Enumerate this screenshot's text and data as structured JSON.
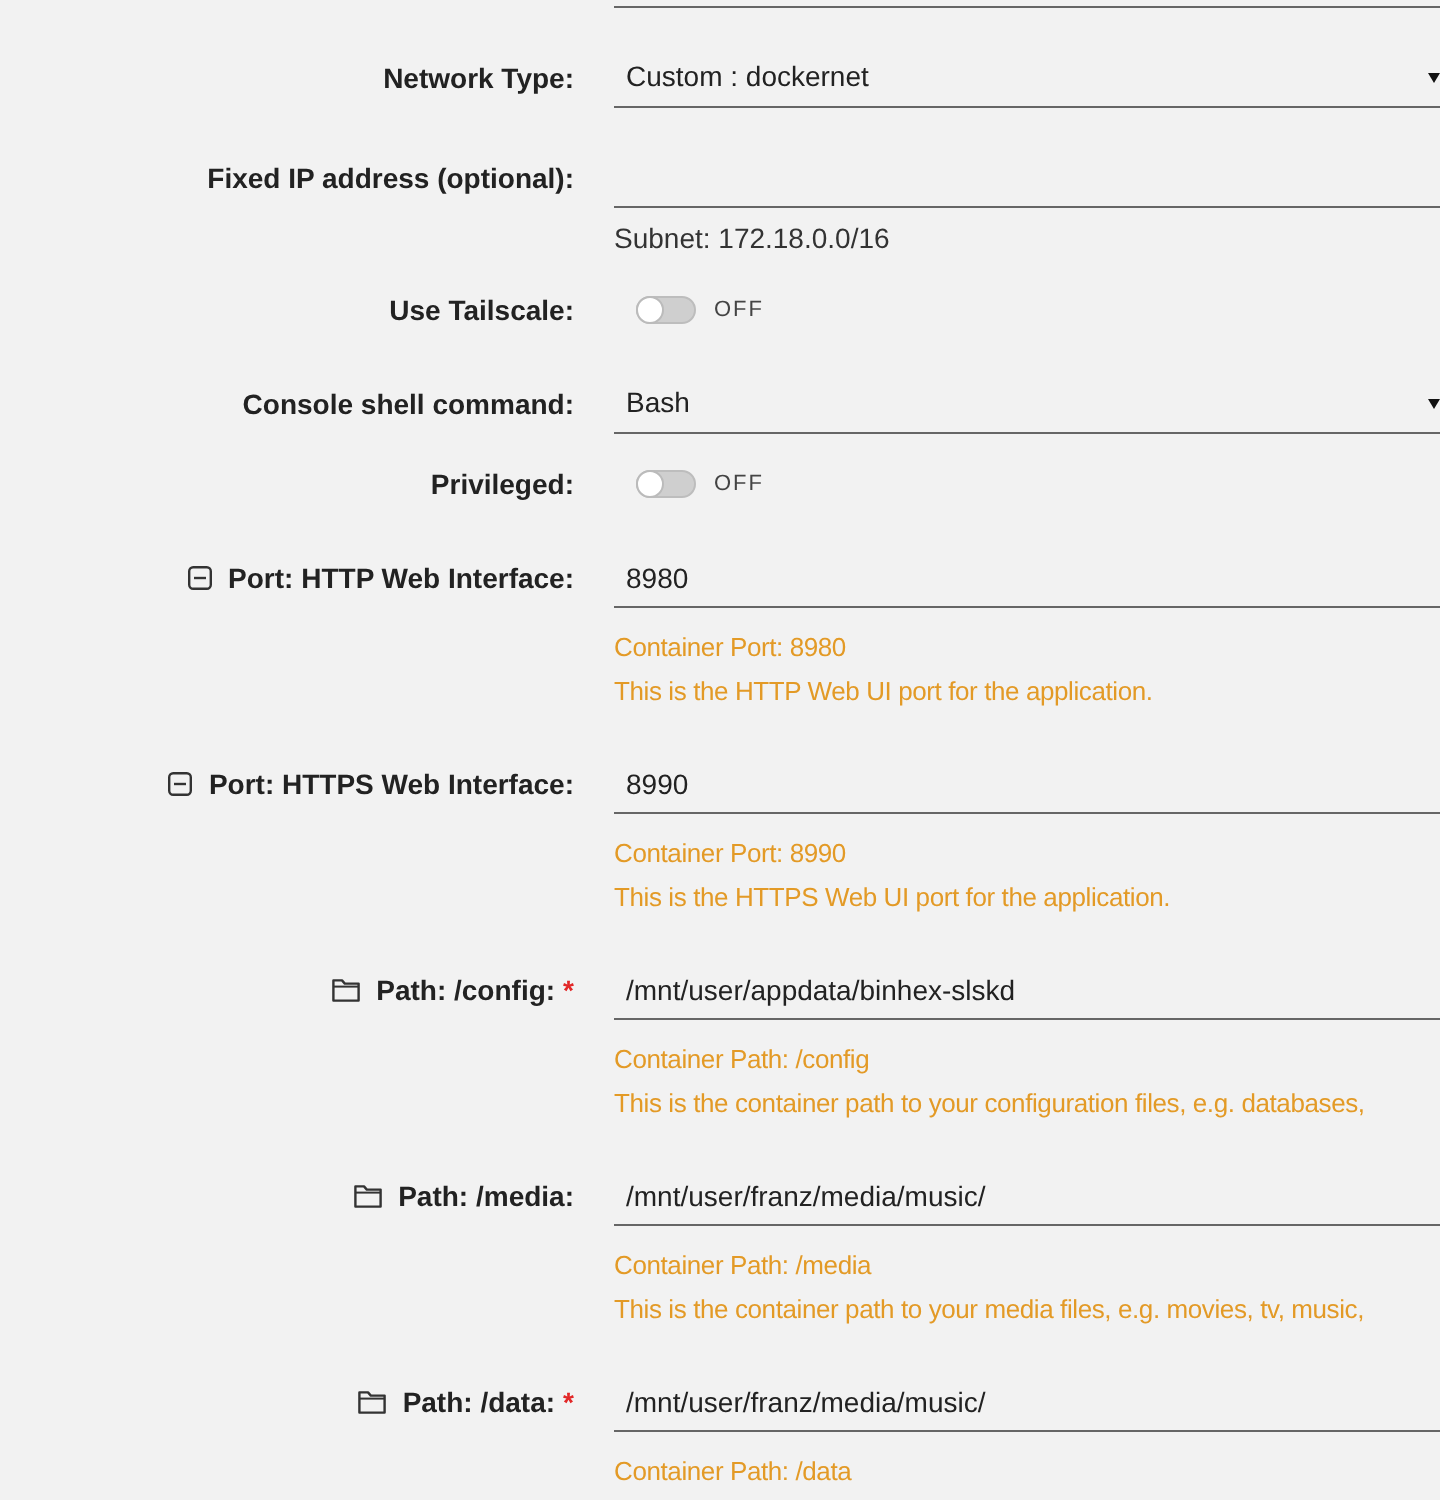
{
  "form": {
    "rows": [
      {
        "kind": "select",
        "label": "Network Type:",
        "value": "Custom : dockernet"
      },
      {
        "kind": "text",
        "label": "Fixed IP address (optional):",
        "notes": [
          {
            "kind": "info",
            "text": "Subnet: 172.18.0.0/16"
          }
        ]
      },
      {
        "kind": "toggle",
        "label": "Use Tailscale:",
        "on": false,
        "state_text": "OFF"
      },
      {
        "kind": "select",
        "label": "Console shell command:",
        "value": "Bash"
      },
      {
        "kind": "toggle",
        "label": "Privileged:",
        "on": false,
        "state_text": "OFF"
      },
      {
        "kind": "port",
        "label": "Port: HTTP Web Interface:",
        "value": "8980",
        "notes": [
          {
            "kind": "help",
            "text": "Container Port: 8980"
          },
          {
            "kind": "help",
            "text": "This is the HTTP Web UI port for the application."
          }
        ]
      },
      {
        "kind": "port",
        "label": "Port: HTTPS Web Interface:",
        "value": "8990",
        "notes": [
          {
            "kind": "help",
            "text": "Container Port: 8990"
          },
          {
            "kind": "help",
            "text": "This is the HTTPS Web UI port for the application."
          }
        ]
      },
      {
        "kind": "path",
        "label": "Path: /config:",
        "required_mark": "*",
        "value": "/mnt/user/appdata/binhex-slskd",
        "notes": [
          {
            "kind": "help",
            "text": "Container Path: /config"
          },
          {
            "kind": "help",
            "text": "This is the container path to your configuration files, e.g. databases,"
          }
        ]
      },
      {
        "kind": "path",
        "label": "Path: /media:",
        "value": "/mnt/user/franz/media/music/",
        "notes": [
          {
            "kind": "help",
            "text": "Container Path: /media"
          },
          {
            "kind": "help",
            "text": "This is the container path to your media files, e.g. movies, tv, music,"
          }
        ]
      },
      {
        "kind": "path",
        "label": "Path: /data:",
        "required_mark": "*",
        "value": "/mnt/user/franz/media/music/",
        "notes": [
          {
            "kind": "help",
            "text": "Container Path: /data"
          }
        ]
      }
    ]
  }
}
